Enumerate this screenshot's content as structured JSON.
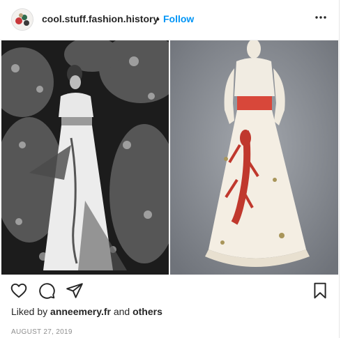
{
  "header": {
    "username": "cool.stuff.fashion.history",
    "separator": "•",
    "follow_label": "Follow",
    "more_icon": "more-horizontal-icon"
  },
  "photo": {
    "left_panel": "black-and-white photo of woman in white gown in a garden",
    "right_panel": "white gown with red lobster print and red sash on mannequin"
  },
  "actions": {
    "like_icon": "heart-icon",
    "comment_icon": "comment-icon",
    "share_icon": "paper-plane-icon",
    "save_icon": "bookmark-icon"
  },
  "likes": {
    "prefix": "Liked by",
    "user": "anneemery.fr",
    "conjunction": "and",
    "others": "others"
  },
  "date": "AUGUST 27, 2019",
  "colors": {
    "follow": "#0095f6",
    "text": "#262626",
    "muted": "#8e8e8e",
    "sash": "#d8473a"
  }
}
